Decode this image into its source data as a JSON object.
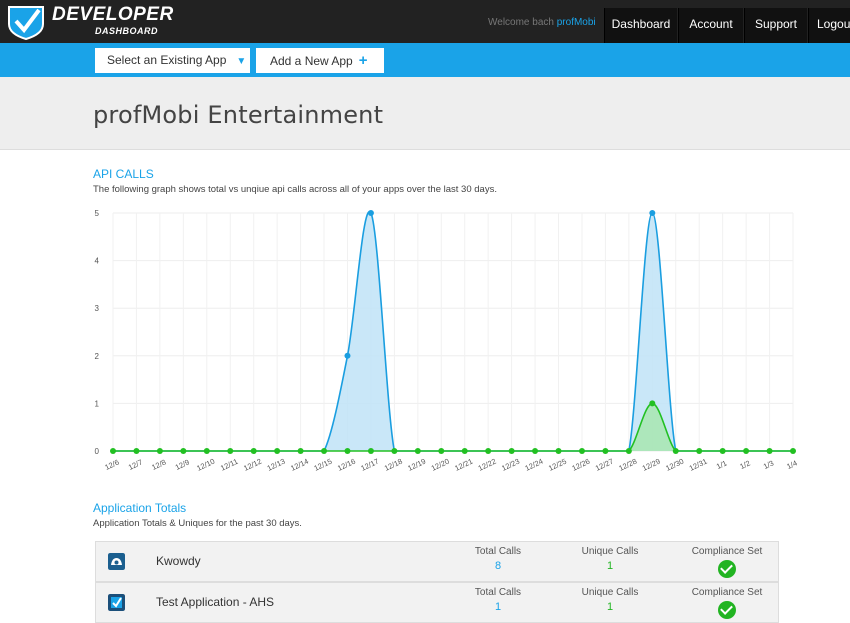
{
  "topbar": {
    "brand": "DEVELOPER",
    "brand_sub": "DASHBOARD",
    "welcome_prefix": "Welcome bach",
    "welcome_user": "profMobi",
    "nav": [
      {
        "label": "Dashboard"
      },
      {
        "label": "Account"
      },
      {
        "label": "Support"
      },
      {
        "label": "Logout"
      }
    ]
  },
  "appbar": {
    "select_app_label": "Select an Existing App",
    "add_app_label": "Add a New App"
  },
  "header": {
    "title": "profMobi Entertainment"
  },
  "api_calls": {
    "title": "API CALLS",
    "description": "The following graph shows total vs unqiue api calls across all of your apps over the last 30 days."
  },
  "chart_data": {
    "type": "area",
    "x": [
      "12/6",
      "12/7",
      "12/8",
      "12/9",
      "12/10",
      "12/11",
      "12/12",
      "12/13",
      "12/14",
      "12/15",
      "12/16",
      "12/17",
      "12/18",
      "12/19",
      "12/20",
      "12/21",
      "12/22",
      "12/23",
      "12/24",
      "12/25",
      "12/26",
      "12/27",
      "12/28",
      "12/29",
      "12/30",
      "12/31",
      "1/1",
      "1/2",
      "1/3",
      "1/4"
    ],
    "series": [
      {
        "values": [
          0,
          0,
          0,
          0,
          0,
          0,
          0,
          0,
          0,
          0,
          2,
          5,
          0,
          0,
          0,
          0,
          0,
          0,
          0,
          0,
          0,
          0,
          0,
          5,
          0,
          0,
          0,
          0,
          0,
          0
        ],
        "color": "#1a9ee0",
        "fill": "#bfe3f7"
      },
      {
        "values": [
          0,
          0,
          0,
          0,
          0,
          0,
          0,
          0,
          0,
          0,
          0,
          0,
          0,
          0,
          0,
          0,
          0,
          0,
          0,
          0,
          0,
          0,
          0,
          1,
          0,
          0,
          0,
          0,
          0,
          0
        ],
        "color": "#22c022",
        "fill": "#a8e6b0"
      }
    ],
    "ylim": [
      0,
      5
    ],
    "yticks": [
      0,
      1,
      2,
      3,
      4,
      5
    ],
    "grid": true
  },
  "totals": {
    "title": "Application Totals",
    "description": "Application Totals & Uniques for the past 30 days.",
    "col_total": "Total Calls",
    "col_unique": "Unique Calls",
    "col_compliance": "Compliance Set",
    "apps": [
      {
        "name": "Kwowdy",
        "total": "8",
        "unique": "1"
      },
      {
        "name": "Test Application - AHS",
        "total": "1",
        "unique": "1"
      }
    ]
  },
  "colors": {
    "accent": "#1aa3e8",
    "topbar": "#222222",
    "unique_green": "#22b422"
  }
}
